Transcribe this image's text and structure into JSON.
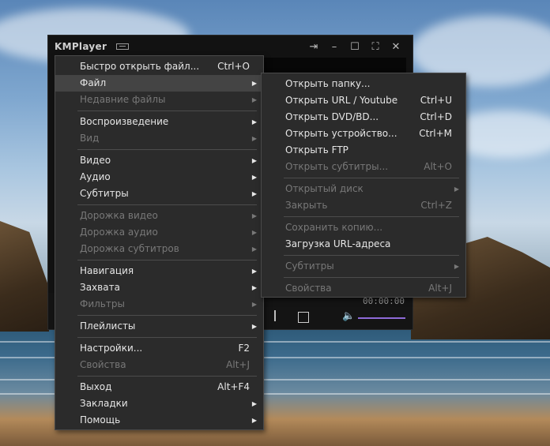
{
  "player": {
    "title": "KMPlayer",
    "time_display": "00:00:00",
    "icons": [
      "menu-icon",
      "pin-icon",
      "minimize-icon",
      "maximize-icon",
      "fullscreen-icon",
      "close-icon",
      "stop-icon",
      "prev-icon",
      "volume-icon"
    ]
  },
  "main_menu": {
    "items": [
      {
        "label": "Быстро открыть файл...",
        "shortcut": "Ctrl+O"
      },
      {
        "label": "Файл"
      },
      {
        "label": "Недавние файлы"
      },
      {
        "label": "Воспроизведение"
      },
      {
        "label": "Вид"
      },
      {
        "label": "Видео"
      },
      {
        "label": "Аудио"
      },
      {
        "label": "Субтитры"
      },
      {
        "label": "Дорожка видео"
      },
      {
        "label": "Дорожка аудио"
      },
      {
        "label": "Дорожка субтитров"
      },
      {
        "label": "Навигация"
      },
      {
        "label": "Захвата"
      },
      {
        "label": "Фильтры"
      },
      {
        "label": "Плейлисты"
      },
      {
        "label": "Настройки...",
        "shortcut": "F2"
      },
      {
        "label": "Свойства",
        "shortcut": "Alt+J"
      },
      {
        "label": "Выход",
        "shortcut": "Alt+F4"
      },
      {
        "label": "Закладки"
      },
      {
        "label": "Помощь"
      }
    ]
  },
  "file_submenu": {
    "items": [
      {
        "label": "Открыть папку..."
      },
      {
        "label": "Открыть URL / Youtube",
        "shortcut": "Ctrl+U"
      },
      {
        "label": "Открыть DVD/BD...",
        "shortcut": "Ctrl+D"
      },
      {
        "label": "Открыть устройство...",
        "shortcut": "Ctrl+M"
      },
      {
        "label": "Открыть FTP"
      },
      {
        "label": "Открыть субтитры...",
        "shortcut": "Alt+O"
      },
      {
        "label": "Открытый диск"
      },
      {
        "label": "Закрыть",
        "shortcut": "Ctrl+Z"
      },
      {
        "label": "Сохранить копию..."
      },
      {
        "label": "Загрузка URL-адреса"
      },
      {
        "label": "Субтитры"
      },
      {
        "label": "Свойства",
        "shortcut": "Alt+J"
      }
    ]
  },
  "colors": {
    "menu_bg": "#2b2b2b",
    "highlight": "#444444",
    "accent": "#8e6ad8"
  }
}
